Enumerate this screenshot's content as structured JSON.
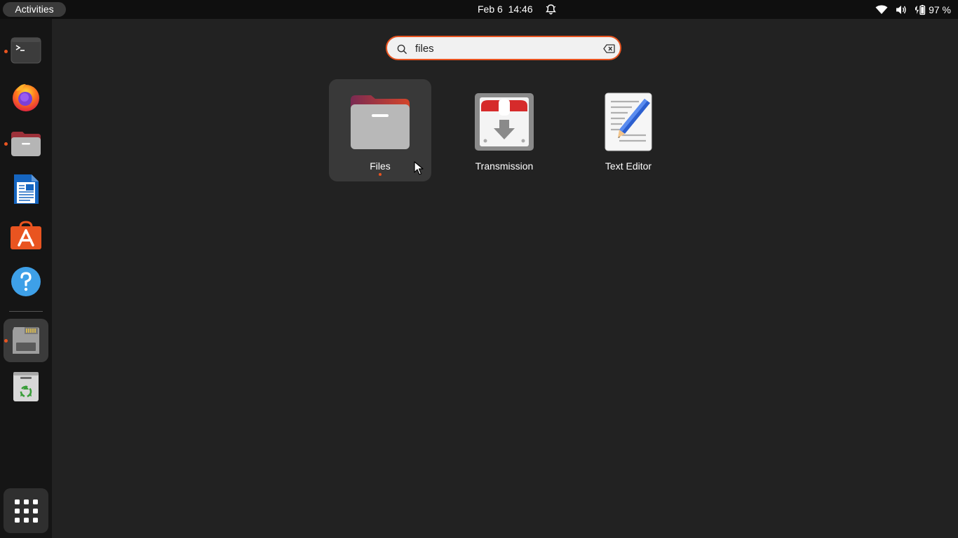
{
  "topbar": {
    "activities_label": "Activities",
    "clock": "Feb 6  14:46",
    "battery_percent": "97 %",
    "icons": [
      "bell-icon",
      "wifi-icon",
      "volume-icon",
      "battery-icon"
    ]
  },
  "dock": {
    "items": [
      {
        "name": "terminal",
        "icon": "terminal-icon",
        "running": true
      },
      {
        "name": "firefox",
        "icon": "firefox-icon",
        "running": false
      },
      {
        "name": "files",
        "icon": "folder-icon",
        "running": true
      },
      {
        "name": "writer",
        "icon": "writer-icon",
        "running": false
      },
      {
        "name": "app-center",
        "icon": "app-store-icon",
        "running": false
      },
      {
        "name": "help",
        "icon": "help-icon",
        "running": false
      },
      {
        "name": "disk-drive",
        "icon": "sd-card-icon",
        "running": true,
        "active": true
      },
      {
        "name": "trash",
        "icon": "trash-icon",
        "running": false
      }
    ],
    "show_apps_icon": "grid-icon"
  },
  "search": {
    "value": "files",
    "icon": "search-icon",
    "clear_icon": "backspace-icon"
  },
  "results": [
    {
      "label": "Files",
      "icon": "folder-icon",
      "running": true,
      "hovered": true
    },
    {
      "label": "Transmission",
      "icon": "transmission-icon",
      "running": false
    },
    {
      "label": "Text Editor",
      "icon": "text-editor-icon",
      "running": false
    }
  ],
  "colors": {
    "accent": "#e95420",
    "background": "#222222",
    "topbar": "#0f0f0f",
    "dock": "#151515"
  }
}
